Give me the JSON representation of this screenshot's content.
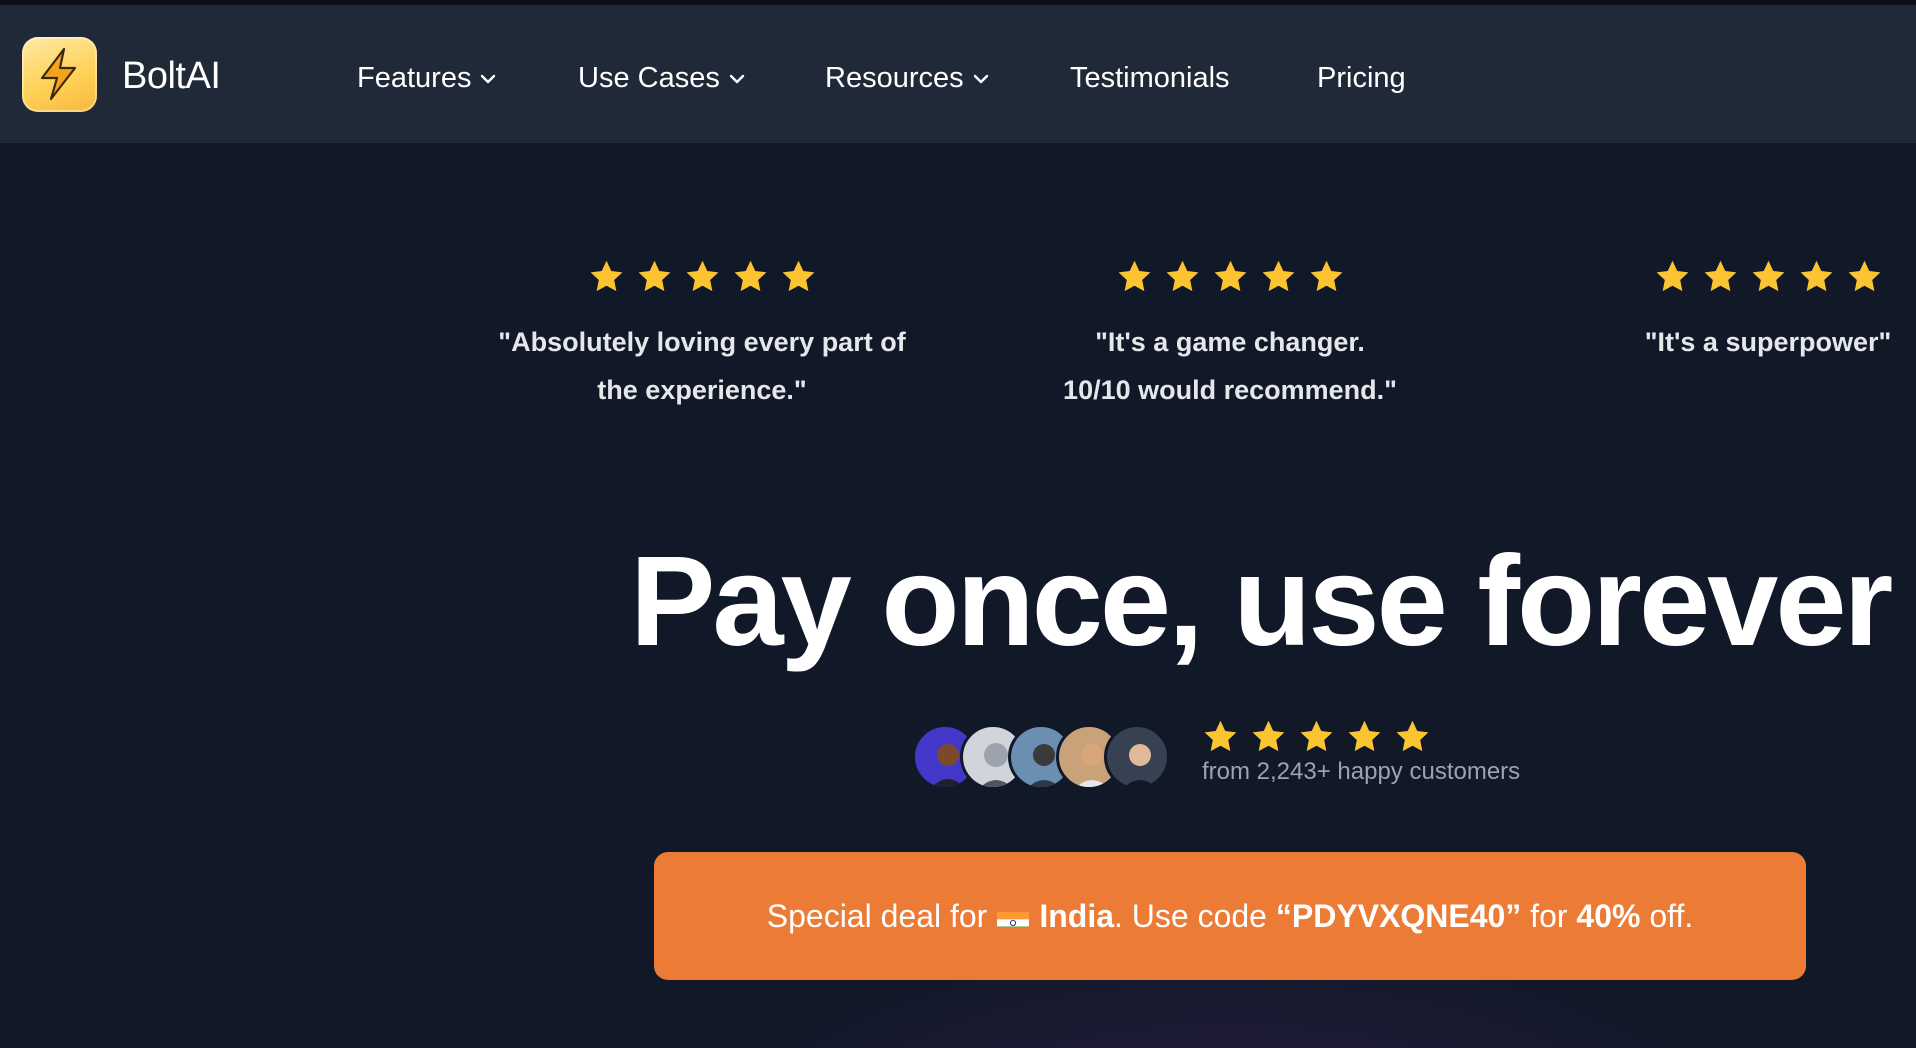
{
  "brand": {
    "name": "BoltAI",
    "logo_icon": "lightning-bolt-icon"
  },
  "nav": {
    "features": "Features",
    "use_cases": "Use Cases",
    "resources": "Resources",
    "testimonials": "Testimonials",
    "pricing": "Pricing"
  },
  "testimonials": [
    {
      "line1": "\"Absolutely loving every part of",
      "line2": "the experience.\"",
      "stars": 5
    },
    {
      "line1": "\"It's a game changer.",
      "line2": "10/10 would recommend.\"",
      "stars": 5
    },
    {
      "line1": "\"It's a superpower\"",
      "line2": "",
      "stars": 5
    }
  ],
  "hero": {
    "headline": "Pay once, use forever",
    "rating_stars": 5,
    "rating_text": "from 2,243+ happy customers"
  },
  "deal": {
    "prefix": "Special deal for",
    "country": "India",
    "mid": ". Use code ",
    "code": "“PDYVXQNE40”",
    "for": " for ",
    "discount": "40%",
    "suffix": " off."
  },
  "colors": {
    "navbar": "#1f2937",
    "page_bg": "#111827",
    "star": "#fbc531",
    "deal_bg": "#ec7b36"
  }
}
